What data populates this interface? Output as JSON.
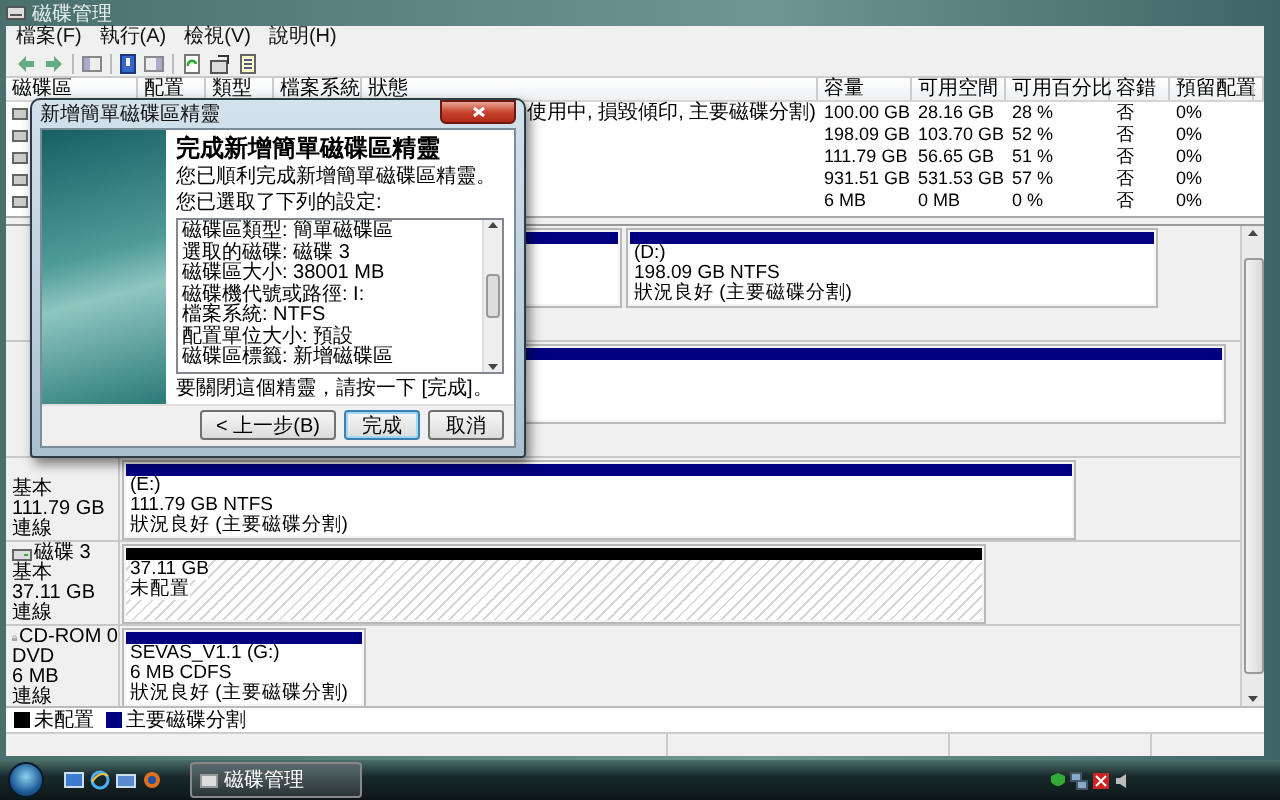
{
  "window": {
    "title": "磁碟管理"
  },
  "menu": [
    {
      "label": "檔案(F)"
    },
    {
      "label": "執行(A)"
    },
    {
      "label": "檢視(V)"
    },
    {
      "label": "說明(H)"
    }
  ],
  "volume_table": {
    "columns": [
      "磁碟區",
      "配置",
      "類型",
      "檔案系統",
      "狀態",
      "容量",
      "可用空間",
      "可用百分比",
      "容錯",
      "預留配置"
    ],
    "rows": [
      {
        "status": "使用中, 損毀傾印, 主要磁碟分割)",
        "capacity": "100.00 GB",
        "free": "28.16 GB",
        "percent_free": "28 %",
        "fault_tolerance": "否",
        "overhead": "0%"
      },
      {
        "capacity": "198.09 GB",
        "free": "103.70 GB",
        "percent_free": "52 %",
        "fault_tolerance": "否",
        "overhead": "0%"
      },
      {
        "capacity": "111.79 GB",
        "free": "56.65 GB",
        "percent_free": "51 %",
        "fault_tolerance": "否",
        "overhead": "0%"
      },
      {
        "capacity": "931.51 GB",
        "free": "531.53 GB",
        "percent_free": "57 %",
        "fault_tolerance": "否",
        "overhead": "0%"
      },
      {
        "capacity": "6 MB",
        "free": "0 MB",
        "percent_free": "0 %",
        "fault_tolerance": "否",
        "overhead": "0%"
      }
    ]
  },
  "disks": [
    {
      "partitions": [
        {
          "kind": "primary"
        },
        {
          "kind": "primary",
          "lines": [
            "(D:)",
            "198.09 GB NTFS",
            "狀況良好 (主要磁碟分割)"
          ]
        }
      ]
    },
    {
      "partitions": [
        {
          "kind": "primary"
        }
      ]
    },
    {
      "details": [
        "基本",
        "111.79 GB",
        "連線"
      ],
      "partitions": [
        {
          "kind": "primary",
          "lines": [
            "(E:)",
            "111.79 GB NTFS",
            "狀況良好 (主要磁碟分割)"
          ]
        }
      ]
    },
    {
      "kind": "disk",
      "name": "磁碟 3",
      "details": [
        "基本",
        "37.11 GB",
        "連線"
      ],
      "partitions": [
        {
          "kind": "unallocated",
          "lines": [
            "37.11 GB",
            "未配置"
          ]
        }
      ]
    },
    {
      "kind": "cdrom",
      "name": "CD-ROM 0",
      "details": [
        "DVD",
        "6 MB",
        "連線"
      ],
      "partitions": [
        {
          "kind": "primary",
          "lines": [
            "SEVAS_V1.1  (G:)",
            "6 MB CDFS",
            "狀況良好 (主要磁碟分割)"
          ]
        }
      ]
    }
  ],
  "legend": [
    {
      "label": "未配置",
      "color": "#000000"
    },
    {
      "label": "主要磁碟分割",
      "color": "#000080"
    }
  ],
  "wizard": {
    "title": "新增簡單磁碟區精靈",
    "heading": "完成新增簡單磁碟區精靈",
    "intro": "您已順利完成新增簡單磁碟區精靈。",
    "settings_label": "您已選取了下列的設定:",
    "settings": [
      "磁碟區類型: 簡單磁碟區",
      "選取的磁碟: 磁碟 3",
      "磁碟區大小: 38001 MB",
      "磁碟機代號或路徑: I:",
      "檔案系統: NTFS",
      "配置單位大小: 預設",
      "磁碟區標籤: 新增磁碟區"
    ],
    "closing": "要關閉這個精靈，請按一下 [完成]。",
    "buttons": [
      {
        "label": "< 上一步(B)",
        "focused": false
      },
      {
        "label": "完成",
        "focused": true
      },
      {
        "label": "取消",
        "focused": false
      }
    ]
  },
  "taskbar": {
    "buttons": [
      {
        "label": "磁碟管理",
        "selected": true
      }
    ]
  }
}
